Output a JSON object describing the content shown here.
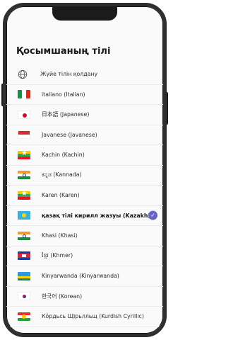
{
  "screen": {
    "title": "Қосымшаның тілі",
    "languages": [
      {
        "label": "Жүйе тілін қолдану",
        "icon": "globe-icon",
        "selected": false
      },
      {
        "label": "italiano (Italian)",
        "icon": "flag-italy-icon",
        "selected": false
      },
      {
        "label": "日本語 (Japanese)",
        "icon": "flag-japan-icon",
        "selected": false
      },
      {
        "label": "Javanese (Javanese)",
        "icon": "flag-indonesia-icon",
        "selected": false
      },
      {
        "label": "Kachin (Kachin)",
        "icon": "flag-myanmar-icon",
        "selected": false
      },
      {
        "label": "ಕನ್ನಡ (Kannada)",
        "icon": "flag-india-icon",
        "selected": false
      },
      {
        "label": "Karen (Karen)",
        "icon": "flag-myanmar-icon",
        "selected": false
      },
      {
        "label": "қазақ тілі кирилл жазуы (Kazakh)",
        "icon": "flag-kazakhstan-icon",
        "selected": true
      },
      {
        "label": "Khasi (Khasi)",
        "icon": "flag-india-icon",
        "selected": false
      },
      {
        "label": "ខ្មែរ (Khmer)",
        "icon": "flag-cambodia-icon",
        "selected": false
      },
      {
        "label": "Kinyarwanda (Kinyarwanda)",
        "icon": "flag-rwanda-icon",
        "selected": false
      },
      {
        "label": "한국어 (Korean)",
        "icon": "flag-korea-icon",
        "selected": false
      },
      {
        "label": "Кӧрдьсь Щїрьлльщ (Kurdish Cyrillic)",
        "icon": "flag-kurdistan-icon",
        "selected": false
      }
    ],
    "check_icon": "check-circle-icon",
    "accent_color": "#6b62c8"
  }
}
